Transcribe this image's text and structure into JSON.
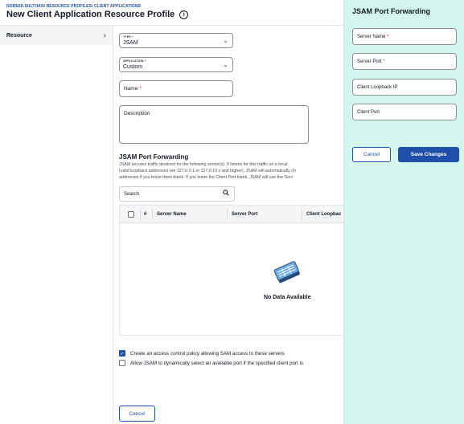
{
  "breadcrumb": "NODE66-SULTHAN/ RESOURCE PROFILES/ CLIENT APPLICATIONS",
  "page_title": "New Client Application Resource Profile",
  "nav": {
    "resource_label": "Resource"
  },
  "form": {
    "type_caption": "TYPE *",
    "type_value": "JSAM",
    "application_caption": "APPLICATION *",
    "application_value": "Custom",
    "name_label": "Name",
    "name_required": "*",
    "description_label": "Description"
  },
  "jsam": {
    "title": "JSAM Port Forwarding",
    "desc_line1": "JSAM secures traffic destined for the following server(s). It listens for this traffic on a local",
    "desc_line2": "(valid loopback addresses are 127.0.0.1 or 127.0.10.x and higher). JSAM will automatically ch",
    "desc_line3": "addresses if you leave them blank. If you leave the Client Port blank, JSAM will use the Serv",
    "search_placeholder": "Search",
    "columns": {
      "index": "#",
      "server_name": "Server Name",
      "server_port": "Server Port",
      "client_loopback": "Client Loopbac"
    },
    "empty_text": "No Data Available"
  },
  "options": {
    "create_policy": {
      "label": "Create an access control policy allowing SAM access to these servers",
      "checked": true
    },
    "dynamic_port": {
      "label": "Allow JSAM to dynamically select an available port if the specified client port is",
      "checked": false
    }
  },
  "footer": {
    "cancel_label": "Cancel"
  },
  "panel": {
    "title": "JSAM Port Forwarding",
    "server_name_label": "Server Name",
    "server_port_label": "Server Port",
    "required_mark": "*",
    "client_loopback_label": "Client Loopback IP",
    "client_port_label": "Client Port",
    "cancel_label": "Cancel",
    "save_label": "Save Changes"
  }
}
